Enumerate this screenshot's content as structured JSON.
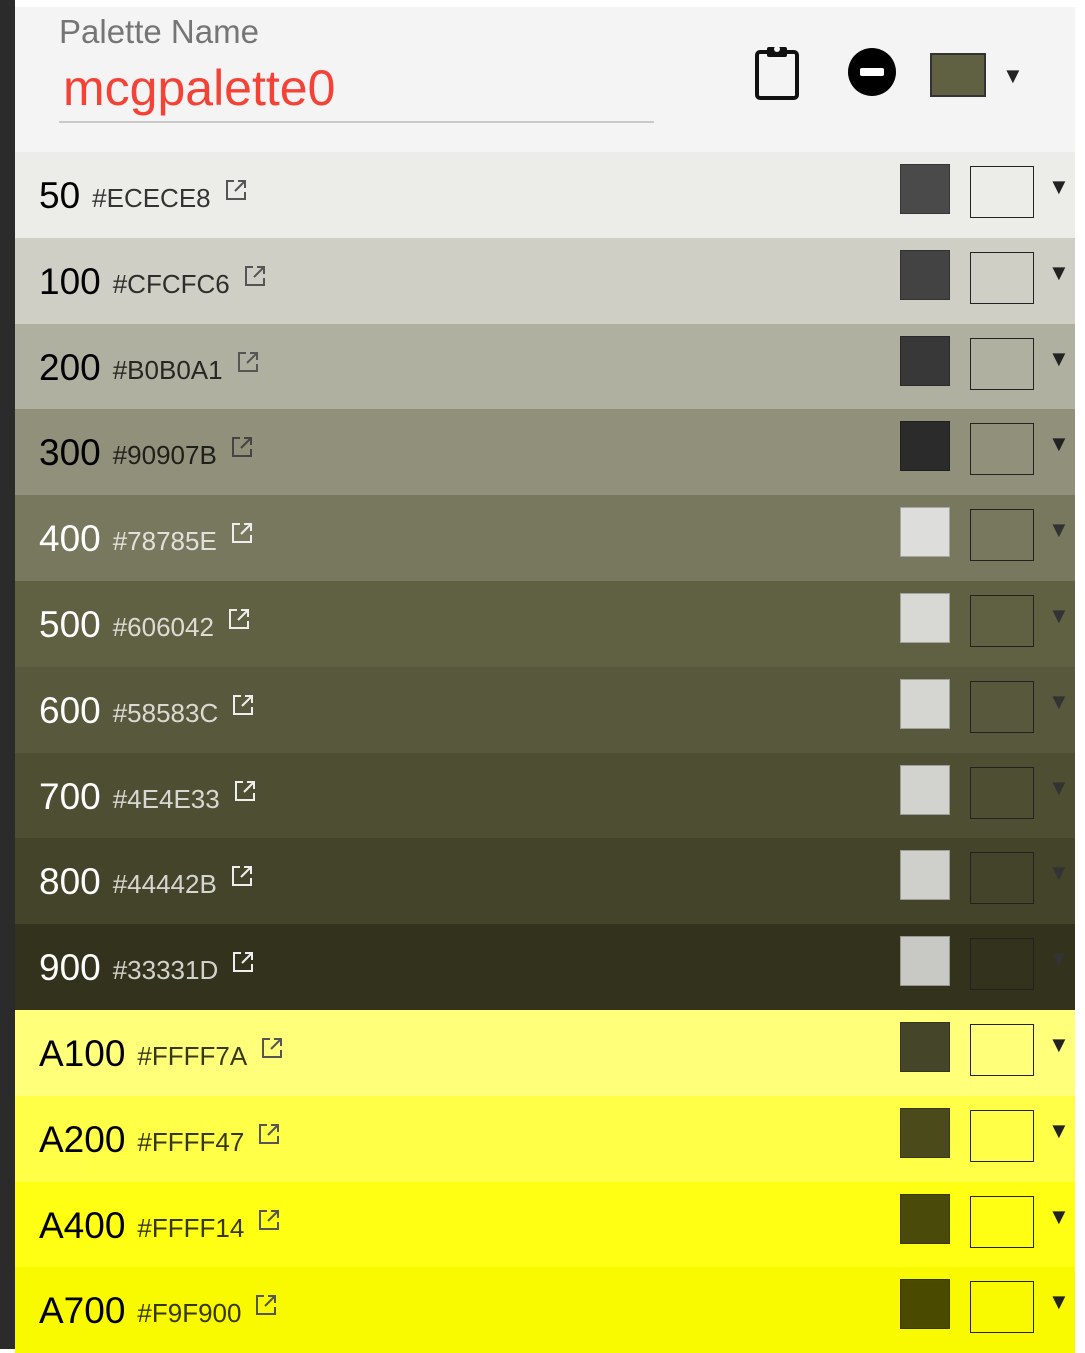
{
  "header": {
    "label": "Palette Name",
    "name": "mcgpalette0",
    "base_color": "#606042"
  },
  "rows": [
    {
      "shade": "50",
      "hex": "#ECECE8",
      "bg": "#ececE8",
      "fg": "#000000",
      "text_swatch": "#4a4a4a",
      "ext_color": "#555555",
      "arrow_color": "#222222"
    },
    {
      "shade": "100",
      "hex": "#CFCFC6",
      "bg": "#cfcfc6",
      "fg": "#000000",
      "text_swatch": "#434343",
      "ext_color": "#555555",
      "arrow_color": "#222222"
    },
    {
      "shade": "200",
      "hex": "#B0B0A1",
      "bg": "#b0b0a1",
      "fg": "#000000",
      "text_swatch": "#383838",
      "ext_color": "#555555",
      "arrow_color": "#222222"
    },
    {
      "shade": "300",
      "hex": "#90907B",
      "bg": "#90907b",
      "fg": "#000000",
      "text_swatch": "#2b2b2b",
      "ext_color": "#444444",
      "arrow_color": "#222222"
    },
    {
      "shade": "400",
      "hex": "#78785E",
      "bg": "#78785e",
      "fg": "#ffffff",
      "text_swatch": "#dddddb",
      "ext_color": "#eeeeee",
      "arrow_color": "#333333"
    },
    {
      "shade": "500",
      "hex": "#606042",
      "bg": "#606042",
      "fg": "#ffffff",
      "text_swatch": "#d8d8d5",
      "ext_color": "#eeeeee",
      "arrow_color": "#333333"
    },
    {
      "shade": "600",
      "hex": "#58583C",
      "bg": "#58583c",
      "fg": "#ffffff",
      "text_swatch": "#d5d5d2",
      "ext_color": "#eeeeee",
      "arrow_color": "#333333"
    },
    {
      "shade": "700",
      "hex": "#4E4E33",
      "bg": "#4e4e33",
      "fg": "#ffffff",
      "text_swatch": "#d2d2cf",
      "ext_color": "#eeeeee",
      "arrow_color": "#333333"
    },
    {
      "shade": "800",
      "hex": "#44442B",
      "bg": "#44442b",
      "fg": "#ffffff",
      "text_swatch": "#cfcfcc",
      "ext_color": "#eeeeee",
      "arrow_color": "#333333"
    },
    {
      "shade": "900",
      "hex": "#33331D",
      "bg": "#33331d",
      "fg": "#ffffff",
      "text_swatch": "#c8c8c5",
      "ext_color": "#eeeeee",
      "arrow_color": "#333333"
    },
    {
      "shade": "A100",
      "hex": "#FFFF7A",
      "bg": "#ffff7a",
      "fg": "#000000",
      "text_swatch": "#45452a",
      "ext_color": "#555555",
      "arrow_color": "#222222"
    },
    {
      "shade": "A200",
      "hex": "#FFFF47",
      "bg": "#ffff47",
      "fg": "#000000",
      "text_swatch": "#4a4a1a",
      "ext_color": "#555555",
      "arrow_color": "#222222"
    },
    {
      "shade": "A400",
      "hex": "#FFFF14",
      "bg": "#ffff14",
      "fg": "#000000",
      "text_swatch": "#4a4a0a",
      "ext_color": "#555555",
      "arrow_color": "#222222"
    },
    {
      "shade": "A700",
      "hex": "#F9F900",
      "bg": "#f9f900",
      "fg": "#000000",
      "text_swatch": "#4a4a00",
      "ext_color": "#555555",
      "arrow_color": "#222222"
    }
  ]
}
